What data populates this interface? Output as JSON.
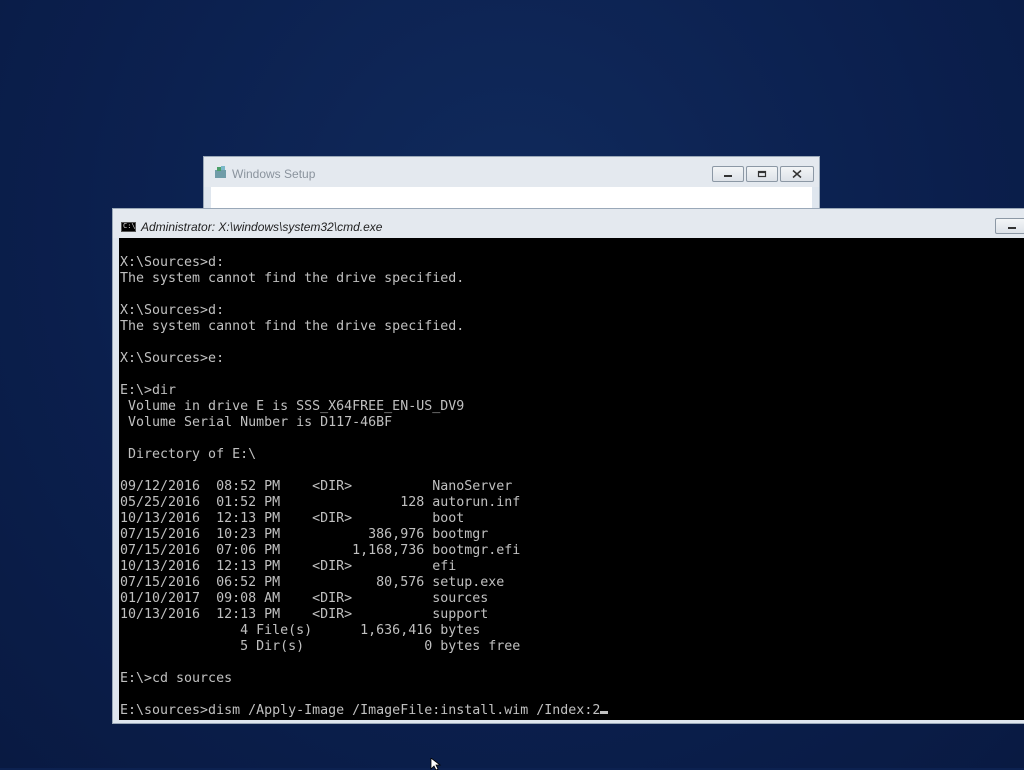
{
  "setup_window": {
    "title": "Windows Setup"
  },
  "cmd_window": {
    "title": "Administrator: X:\\windows\\system32\\cmd.exe",
    "icon_label": "C:\\",
    "console_lines": [
      "X:\\Sources>d:",
      "The system cannot find the drive specified.",
      "",
      "X:\\Sources>d:",
      "The system cannot find the drive specified.",
      "",
      "X:\\Sources>e:",
      "",
      "E:\\>dir",
      " Volume in drive E is SSS_X64FREE_EN-US_DV9",
      " Volume Serial Number is D117-46BF",
      "",
      " Directory of E:\\",
      "",
      "09/12/2016  08:52 PM    <DIR>          NanoServer",
      "05/25/2016  01:52 PM               128 autorun.inf",
      "10/13/2016  12:13 PM    <DIR>          boot",
      "07/15/2016  10:23 PM           386,976 bootmgr",
      "07/15/2016  07:06 PM         1,168,736 bootmgr.efi",
      "10/13/2016  12:13 PM    <DIR>          efi",
      "07/15/2016  06:52 PM            80,576 setup.exe",
      "01/10/2017  09:08 AM    <DIR>          sources",
      "10/13/2016  12:13 PM    <DIR>          support",
      "               4 File(s)      1,636,416 bytes",
      "               5 Dir(s)               0 bytes free",
      "",
      "E:\\>cd sources",
      ""
    ],
    "prompt_line": "E:\\sources>dism /Apply-Image /ImageFile:install.wim /Index:2"
  }
}
